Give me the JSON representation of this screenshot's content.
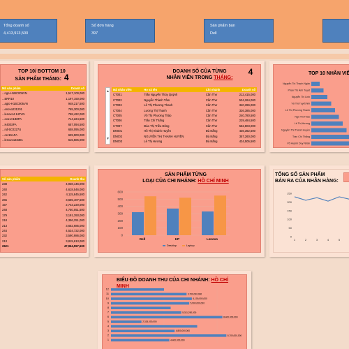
{
  "kpis": [
    {
      "label": "Tổng doanh số",
      "value": "4,413,913,500"
    },
    {
      "label": "Số đơn hàng",
      "value": "397"
    },
    {
      "label": "Sản phẩm bán",
      "value": "Dell"
    },
    {
      "label": "",
      "value": ""
    }
  ],
  "top_products": {
    "title_line1": "TOP 10/ BOTTOM 10",
    "title_line2": "SẢN PHẨM THÁNG:",
    "month": "4",
    "headers": [
      "Mã sản phẩm",
      "Doanh số"
    ],
    "rows": [
      [
        "...ngo-H1BC005VN",
        "1,517,100,000"
      ],
      [
        "...ERR10",
        "1,197,150,000"
      ],
      [
        "...agio-H1BC005VN",
        "948,217,500"
      ],
      [
        "...enovo231201",
        "765,300,000"
      ],
      [
        "...lenovo4.14FVN",
        "758,422,000"
      ],
      [
        "...ovo1A1B0PA",
        "714,224,500"
      ],
      [
        "...K4002FA",
        "657,094,500"
      ],
      [
        "...nd-5C0227U",
        "658,095,000"
      ],
      [
        "...cer15AFA",
        "639,900,000"
      ],
      [
        "...lenovo133301",
        "615,505,000"
      ]
    ]
  },
  "staff_sales": {
    "title_line1": "DOANH SỐ CỦA TỪNG",
    "title_line2": "NHÂN VIÊN TRONG",
    "title_month_label": "THÁNG:",
    "month": "4",
    "headers": [
      "Mã nhân viên",
      "Họ và tên",
      "Chi nhánh",
      "Doanh số"
    ],
    "rows": [
      [
        "CT001",
        "Trần Nguyễn Thúy Quỳnh",
        "Cần Thơ",
        "212,415,000"
      ],
      [
        "CT002",
        "Nguyễn Thành Tâm",
        "Cần Thơ",
        "534,264,000"
      ],
      [
        "CT003",
        "Lê Thị Phương Thanh",
        "Cần Thơ",
        "340,396,000"
      ],
      [
        "CT004",
        "Lương Thị Thanh",
        "Cần Thơ",
        "326,385,000"
      ],
      [
        "CT005",
        "Võ Thị Phương Thảo",
        "Cần Thơ",
        "240,780,500"
      ],
      [
        "CT006",
        "Trần Chí Thắng",
        "Cần Thơ",
        "229,484,500"
      ],
      [
        "CT007",
        "Đào Thị Triều Đông",
        "Cần Thơ",
        "552,803,000"
      ],
      [
        "DN001",
        "Hồ Thị Khánh Huyền",
        "Đà Nẵng",
        "436,362,500"
      ],
      [
        "DN002",
        "NGUYỄN THỊ THANH HUYỀN",
        "Đà Nẵng",
        "357,260,000"
      ],
      [
        "DN003",
        "Lê Thị Hương",
        "Đà Nẵng",
        "434,505,500"
      ]
    ]
  },
  "top10_staff": {
    "title": "TOP 10 NHÂN VIÊN",
    "names": [
      "Nguyễn Thị Thanh Ngân",
      "Phan Thị Ánh Tuyết",
      "Nguyễn Thị Linh",
      "Võ Thị Tuyết Nhi",
      "Lê Thị Phương Thanh",
      "Ngô Thị Thảo",
      "Lê Thị Hương",
      "Nguyễn Thị Thanh Huyền",
      "Trần Chí Thắng",
      "Võ Huỳnh Duy Nhân"
    ]
  },
  "product_qty": {
    "headers": [
      "Số sản phẩm",
      "Doanh thu"
    ],
    "rows": [
      [
        "238",
        "4,938,146,000"
      ],
      [
        "240",
        "4,618,546,000"
      ],
      [
        "242",
        "4,115,845,500"
      ],
      [
        "265",
        "3,665,407,500"
      ],
      [
        "157",
        "2,743,220,000"
      ],
      [
        "248",
        "4,750,051,500"
      ],
      [
        "179",
        "3,191,393,000"
      ],
      [
        "218",
        "4,356,251,000"
      ],
      [
        "213",
        "3,652,685,000"
      ],
      [
        "244",
        "4,534,722,000"
      ],
      [
        "232",
        "3,590,986,000"
      ],
      [
        "213",
        "3,815,613,000"
      ]
    ],
    "total": [
      "2621",
      "47,964,557,500"
    ]
  },
  "branch_products": {
    "title_line1": "SẢN PHẨM TỪNG",
    "title_line2": "LOẠI CỦA CHI NHÁNH:",
    "branch": "HỒ CHÍ MINH",
    "chart_data": {
      "type": "bar",
      "categories": [
        "Dell",
        "HP",
        "Lenovo"
      ],
      "series": [
        {
          "name": "Desktop",
          "values": [
            320,
            370,
            330
          ],
          "color": "#4f81bd"
        },
        {
          "name": "Laptop",
          "values": [
            540,
            520,
            550
          ],
          "color": "#f79646"
        }
      ],
      "ylim": [
        0,
        600
      ],
      "yticks": [
        0,
        100,
        200,
        300,
        400,
        500,
        600
      ]
    }
  },
  "branch_qty": {
    "title_line1": "TỔNG SỐ SẢN PHẨM",
    "title_line2": "BÁN RA CỦA NHÂN HÀNG:",
    "chart_data": {
      "type": "line",
      "x": [
        "1",
        "2",
        "3",
        "4",
        "5",
        "6"
      ],
      "values": [
        230,
        210,
        225,
        205,
        230,
        215
      ],
      "ylim": [
        0,
        250
      ],
      "yticks": [
        0,
        50,
        100,
        150,
        200,
        250
      ],
      "color": "#4f81bd"
    }
  },
  "revenue_chart": {
    "title": "BIỂU ĐỒ DOANH THU CỦA CHI NHÁNH:",
    "branch": "HỒ CHÍ MINH",
    "chart_data": {
      "type": "bar",
      "categories": [
        "12",
        "11",
        "10",
        "9",
        "8",
        "7",
        "6",
        "5",
        "4",
        "3",
        "2",
        "1"
      ],
      "values": [
        4000000000,
        5700000000,
        6100000000,
        5900000000,
        4500000000,
        5300000000,
        8400000000,
        2300000000,
        6500000000,
        4800000000,
        8700000000,
        4400000000
      ],
      "labels": [
        "",
        "3,700,000,000",
        "6,100,000,000",
        "5,900,000,000",
        "",
        "5,311,250,000",
        "8,400,000,000",
        "2,315,000,000",
        "",
        "4,800,000,000",
        "8,700,000,000",
        "4,400,000,000"
      ],
      "xlim": [
        0,
        10000000000
      ],
      "xticks": [
        "0",
        "2,000,000,000",
        "4,000,000,000",
        "6,000,000,000",
        "8,000,000,000",
        "10,000,000,000"
      ],
      "color": "#4f81bd"
    }
  }
}
